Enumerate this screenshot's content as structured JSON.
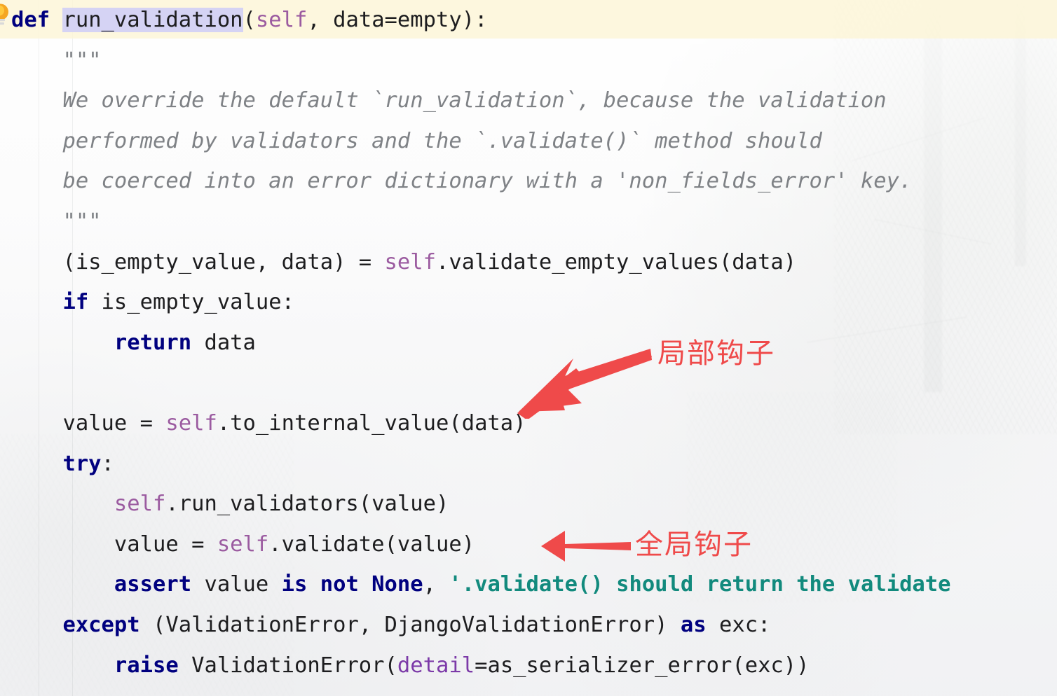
{
  "editor": {
    "language": "python",
    "background_image": "forest-photo-watermark",
    "caret_line_highlight_color": "#fcf5d6",
    "selection_highlight_color": "#d5d3f4",
    "colors": {
      "keyword": "#00007f",
      "self": "#9b5ba0",
      "keyword_argument": "#7c3aa8",
      "string": "#128a7d",
      "docstring": "#7f8286",
      "plain_text": "#1d1d1f",
      "annotation_red": "#ef4a4a"
    }
  },
  "gutter": {
    "intention_bulb_icon": "lightbulb-icon"
  },
  "code": {
    "lines": [
      {
        "id": "def-signature",
        "tokens": [
          {
            "type": "kw",
            "text": "def"
          },
          {
            "type": "plain",
            "text": " "
          },
          {
            "type": "sel",
            "text": "run_validation"
          },
          {
            "type": "plain",
            "text": "("
          },
          {
            "type": "self",
            "text": "self"
          },
          {
            "type": "plain",
            "text": ", data=empty):"
          }
        ]
      },
      {
        "id": "docstring-open",
        "tokens": [
          {
            "type": "doc",
            "text": "    \"\"\""
          }
        ]
      },
      {
        "id": "docstring-line-1",
        "tokens": [
          {
            "type": "doc",
            "text": "    We override the default `run_validation`, because the validation"
          }
        ]
      },
      {
        "id": "docstring-line-2",
        "tokens": [
          {
            "type": "doc",
            "text": "    performed by validators and the `.validate()` method should"
          }
        ]
      },
      {
        "id": "docstring-line-3",
        "tokens": [
          {
            "type": "doc",
            "text": "    be coerced into an error dictionary with a 'non_fields_error' key."
          }
        ]
      },
      {
        "id": "docstring-close",
        "tokens": [
          {
            "type": "doc",
            "text": "    \"\"\""
          }
        ]
      },
      {
        "id": "validate-empty-values",
        "tokens": [
          {
            "type": "plain",
            "text": "    (is_empty_value, data) = "
          },
          {
            "type": "self",
            "text": "self"
          },
          {
            "type": "plain",
            "text": ".validate_empty_values(data)"
          }
        ]
      },
      {
        "id": "if-is-empty-value",
        "tokens": [
          {
            "type": "plain",
            "text": "    "
          },
          {
            "type": "kw",
            "text": "if"
          },
          {
            "type": "plain",
            "text": " is_empty_value:"
          }
        ]
      },
      {
        "id": "return-data",
        "tokens": [
          {
            "type": "plain",
            "text": "        "
          },
          {
            "type": "kw",
            "text": "return"
          },
          {
            "type": "plain",
            "text": " data"
          }
        ]
      },
      {
        "id": "blank-1",
        "tokens": [
          {
            "type": "plain",
            "text": ""
          }
        ]
      },
      {
        "id": "to-internal-value",
        "tokens": [
          {
            "type": "plain",
            "text": "    value = "
          },
          {
            "type": "self",
            "text": "self"
          },
          {
            "type": "plain",
            "text": ".to_internal_value(data)"
          }
        ]
      },
      {
        "id": "try",
        "tokens": [
          {
            "type": "plain",
            "text": "    "
          },
          {
            "type": "kw",
            "text": "try"
          },
          {
            "type": "plain",
            "text": ":"
          }
        ]
      },
      {
        "id": "run-validators",
        "tokens": [
          {
            "type": "plain",
            "text": "        "
          },
          {
            "type": "self",
            "text": "self"
          },
          {
            "type": "plain",
            "text": ".run_validators(value)"
          }
        ]
      },
      {
        "id": "value-validate",
        "tokens": [
          {
            "type": "plain",
            "text": "        value = "
          },
          {
            "type": "self",
            "text": "self"
          },
          {
            "type": "plain",
            "text": ".validate(value)"
          }
        ]
      },
      {
        "id": "assert-not-none",
        "tokens": [
          {
            "type": "plain",
            "text": "        "
          },
          {
            "type": "kw",
            "text": "assert"
          },
          {
            "type": "plain",
            "text": " value "
          },
          {
            "type": "kw",
            "text": "is not None"
          },
          {
            "type": "plain",
            "text": ", "
          },
          {
            "type": "str",
            "text": "'.validate() should return the validate"
          }
        ]
      },
      {
        "id": "except-clause",
        "tokens": [
          {
            "type": "plain",
            "text": "    "
          },
          {
            "type": "kw",
            "text": "except"
          },
          {
            "type": "plain",
            "text": " (ValidationError, DjangoValidationError) "
          },
          {
            "type": "kw",
            "text": "as"
          },
          {
            "type": "plain",
            "text": " exc:"
          }
        ]
      },
      {
        "id": "raise-validation-error",
        "tokens": [
          {
            "type": "plain",
            "text": "        "
          },
          {
            "type": "kw",
            "text": "raise"
          },
          {
            "type": "plain",
            "text": " ValidationError("
          },
          {
            "type": "kwarg",
            "text": "detail"
          },
          {
            "type": "plain",
            "text": "=as_serializer_error(exc))"
          }
        ]
      }
    ]
  },
  "annotations": [
    {
      "id": "local-hook",
      "label": "局部钩子",
      "arrow": "diagonal-left-down-arrow",
      "color": "#ef4a4a",
      "points_at": "to_internal_value / local hook region"
    },
    {
      "id": "global-hook",
      "label": "全局钩子",
      "arrow": "left-arrow",
      "color": "#ef4a4a",
      "points_at": "self.validate(value)"
    }
  ]
}
